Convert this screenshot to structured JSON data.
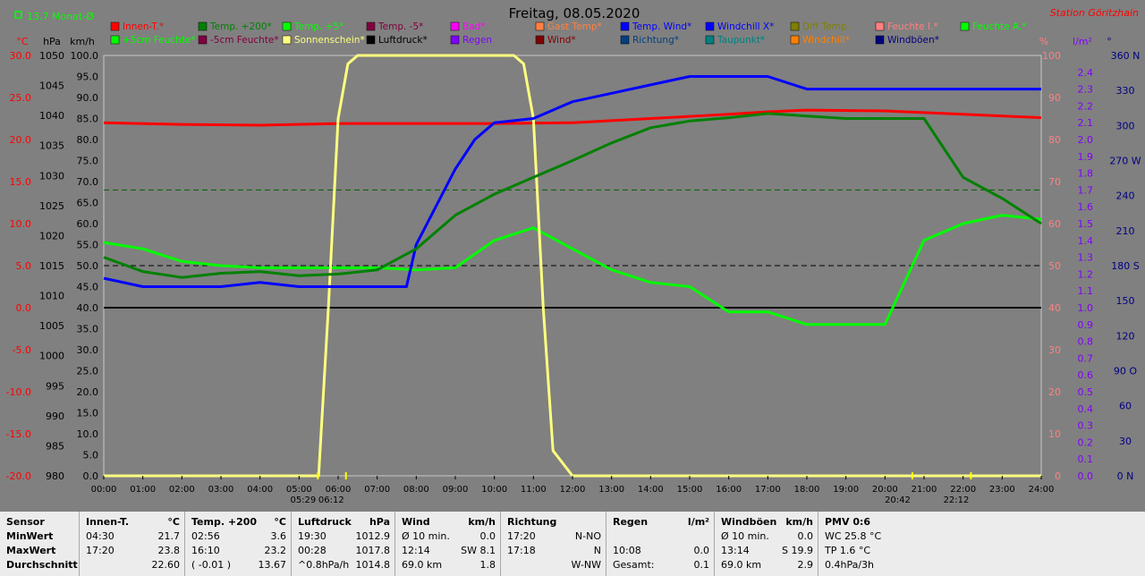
{
  "header": {
    "avg_label": "13.7 Monat-Ø",
    "title": "Freitag, 08.05.2020",
    "station": "Station Göritzhain"
  },
  "chart_data": {
    "type": "line",
    "title": "Freitag, 08.05.2020",
    "x_range": [
      0,
      24
    ],
    "x_ticks": [
      "00:00",
      "01:00",
      "02:00",
      "03:00",
      "04:00",
      "05:00",
      "06:00",
      "07:00",
      "08:00",
      "09:00",
      "10:00",
      "11:00",
      "12:00",
      "13:00",
      "14:00",
      "15:00",
      "16:00",
      "17:00",
      "18:00",
      "19:00",
      "20:00",
      "21:00",
      "22:00",
      "23:00",
      "24:00"
    ],
    "axes": {
      "celsius": {
        "label": "°C",
        "color": "#ff0000",
        "min": -20,
        "max": 30,
        "ticks": [
          "30.0",
          "25.0",
          "20.0",
          "15.0",
          "10.0",
          "5.0",
          "0.0",
          "-5.0",
          "-10.0",
          "-15.0",
          "-20.0"
        ]
      },
      "hpa": {
        "label": "hPa",
        "color": "#000000",
        "min": 980,
        "max": 1050,
        "ticks": [
          "1050",
          "1045",
          "1040",
          "1035",
          "1030",
          "1025",
          "1020",
          "1015",
          "1010",
          "1005",
          "1000",
          "995",
          "990",
          "985",
          "980"
        ]
      },
      "kmh": {
        "label": "km/h",
        "color": "#000000",
        "min": 0,
        "max": 100,
        "ticks": [
          "100.0",
          "95.0",
          "90.0",
          "85.0",
          "80.0",
          "75.0",
          "70.0",
          "65.0",
          "60.0",
          "55.0",
          "50.0",
          "45.0",
          "40.0",
          "35.0",
          "30.0",
          "25.0",
          "20.0",
          "15.0",
          "10.0",
          "5.0",
          "0.0"
        ]
      },
      "percent": {
        "label": "%",
        "color": "#ff8080",
        "min": 0,
        "max": 100,
        "ticks": [
          "100",
          "90",
          "80",
          "70",
          "60",
          "50",
          "40",
          "30",
          "20",
          "10",
          "0"
        ]
      },
      "rain": {
        "label": "l/m²",
        "color": "#8000ff",
        "min": 0,
        "max": 2.5,
        "ticks": [
          "2.4",
          "2.3",
          "2.2",
          "2.1",
          "2.0",
          "1.9",
          "1.8",
          "1.7",
          "1.6",
          "1.5",
          "1.4",
          "1.3",
          "1.2",
          "1.1",
          "1.0",
          "0.9",
          "0.8",
          "0.7",
          "0.6",
          "0.5",
          "0.4",
          "0.3",
          "0.2",
          "0.1",
          "0.0"
        ]
      },
      "direction": {
        "label": "°",
        "color": "#000080",
        "min": 0,
        "max": 360,
        "ticks": [
          "360 N",
          "330",
          "300",
          "270 W",
          "240",
          "210",
          "180 S",
          "150",
          "120",
          "90 O",
          "60",
          "30",
          "0 N"
        ]
      }
    },
    "legend": [
      {
        "name": "Innen-T.*",
        "color": "#ff0000"
      },
      {
        "name": "Temp. +200*",
        "color": "#008000"
      },
      {
        "name": "Temp. +5*",
        "color": "#00ff00"
      },
      {
        "name": "Temp. -5*",
        "color": "#800040"
      },
      {
        "name": "Bad*",
        "color": "#ff00ff"
      },
      {
        "name": "Gast Temp*",
        "color": "#ff8040"
      },
      {
        "name": "Temp. Wind*",
        "color": "#0000ff"
      },
      {
        "name": "Windchill X*",
        "color": "#0000ff"
      },
      {
        "name": "Diff Temp.",
        "color": "#808000"
      },
      {
        "name": "Feuchte I.*",
        "color": "#ff8080"
      },
      {
        "name": "Feuchte A.*",
        "color": "#00ff00"
      },
      {
        "name": "+5cm Feuchte*",
        "color": "#00ff00"
      },
      {
        "name": "-5cm Feuchte*",
        "color": "#800040"
      },
      {
        "name": "Sonnenschein*",
        "color": "#ffff80"
      },
      {
        "name": "Luftdruck*",
        "color": "#000000"
      },
      {
        "name": "Regen",
        "color": "#8000ff"
      },
      {
        "name": "Wind*",
        "color": "#800000"
      },
      {
        "name": "Richtung*",
        "color": "#004080"
      },
      {
        "name": "Taupunkt*",
        "color": "#008080"
      },
      {
        "name": "Windchill*",
        "color": "#ff8000"
      },
      {
        "name": "Windböen*",
        "color": "#000080"
      }
    ],
    "series": [
      {
        "name": "Feuchte A.*",
        "axis": "percent",
        "color": "#00ff00",
        "x": [
          0,
          1,
          2,
          3,
          4,
          5,
          6,
          7,
          8,
          9,
          10,
          11,
          12,
          13,
          14,
          15,
          16,
          17,
          18,
          19,
          20,
          21,
          22,
          23,
          24
        ],
        "values": [
          55.5,
          54,
          51,
          50,
          49.5,
          49.5,
          49.5,
          49.5,
          49,
          49.5,
          56,
          59,
          54,
          49,
          46,
          45,
          39,
          39,
          36,
          36,
          36,
          56,
          60,
          62,
          61
        ]
      },
      {
        "name": "Innen-T.*",
        "axis": "celsius",
        "color": "#ff0000",
        "x": [
          0,
          2,
          4,
          6,
          8,
          10,
          12,
          14,
          16,
          17,
          18,
          20,
          22,
          24
        ],
        "values": [
          22.0,
          21.8,
          21.7,
          21.9,
          21.9,
          21.9,
          22.0,
          22.5,
          23.0,
          23.3,
          23.5,
          23.4,
          23.0,
          22.6
        ]
      },
      {
        "name": "Sonnenschein*",
        "axis": "kmh",
        "color": "#ffff80",
        "x": [
          0,
          5.5,
          5.75,
          6,
          6.25,
          6.5,
          10.5,
          10.75,
          11,
          11.25,
          11.5,
          12,
          24
        ],
        "values": [
          0,
          0,
          40,
          85,
          98,
          100,
          100,
          98,
          85,
          40,
          6,
          0,
          0
        ]
      },
      {
        "name": "Temp. Wind*",
        "axis": "kmh",
        "color": "#0000ff",
        "x": [
          0,
          1,
          2,
          3,
          4,
          5,
          6,
          7,
          7.75,
          8,
          9,
          9.5,
          10,
          11,
          12,
          13,
          14,
          15,
          16,
          17,
          18,
          19,
          24
        ],
        "values": [
          47,
          45,
          45,
          45,
          46,
          45,
          45,
          45,
          45,
          55,
          73,
          80,
          84,
          85,
          89,
          91,
          93,
          95,
          95,
          95,
          92,
          92,
          92
        ]
      },
      {
        "name": "Temp. +200*",
        "axis": "celsius",
        "color": "#008000",
        "x": [
          0,
          1,
          2,
          3,
          4,
          5,
          6,
          7,
          8,
          9,
          10,
          11,
          12,
          13,
          14,
          15,
          16,
          17,
          18,
          19,
          20,
          21,
          22,
          23,
          24
        ],
        "values": [
          6.0,
          4.3,
          3.6,
          4.1,
          4.3,
          3.8,
          4.0,
          4.5,
          7.0,
          11.0,
          13.5,
          15.5,
          17.5,
          19.6,
          21.4,
          22.2,
          22.6,
          23.1,
          22.8,
          22.5,
          22.5,
          22.5,
          15.5,
          13.0,
          10.0
        ]
      }
    ]
  },
  "table": [
    {
      "header": [
        "Sensor"
      ],
      "rows": [
        [
          "MinWert"
        ],
        [
          "MaxWert"
        ],
        [
          "Durchschnitt"
        ]
      ]
    },
    {
      "header": [
        "Innen-T.",
        "°C"
      ],
      "rows": [
        [
          "04:30",
          "21.7"
        ],
        [
          "17:20",
          "23.8"
        ],
        [
          "",
          "22.60"
        ]
      ]
    },
    {
      "header": [
        "Temp. +200",
        "°C"
      ],
      "rows": [
        [
          "02:56",
          "3.6"
        ],
        [
          "16:10",
          "23.2"
        ],
        [
          "( -0.01 )",
          "13.67"
        ]
      ]
    },
    {
      "header": [
        "Luftdruck",
        "hPa"
      ],
      "rows": [
        [
          "19:30",
          "1012.9"
        ],
        [
          "00:28",
          "1017.8"
        ],
        [
          "^0.8hPa/h",
          "1014.8"
        ]
      ]
    },
    {
      "header": [
        "Wind",
        "km/h"
      ],
      "rows": [
        [
          "Ø 10 min.",
          "0.0"
        ],
        [
          "12:14",
          "SW 8.1"
        ],
        [
          "69.0 km",
          "1.8"
        ]
      ]
    },
    {
      "header": [
        "Richtung",
        ""
      ],
      "rows": [
        [
          "17:20",
          "N-NO"
        ],
        [
          "17:18",
          "N"
        ],
        [
          "",
          "W-NW"
        ]
      ]
    },
    {
      "header": [
        "Regen",
        "l/m²"
      ],
      "rows": [
        [
          "",
          ""
        ],
        [
          "10:08",
          "0.0"
        ],
        [
          "Gesamt:",
          "0.1"
        ]
      ]
    },
    {
      "header": [
        "Windböen",
        "km/h"
      ],
      "rows": [
        [
          "Ø 10 min.",
          "0.0"
        ],
        [
          "13:14",
          "S 19.9"
        ],
        [
          "69.0 km",
          "2.9"
        ]
      ]
    },
    {
      "header": [
        "PMV 0:6"
      ],
      "rows": [
        [
          "WC 25.8 °C"
        ],
        [
          "TP 1.6 °C"
        ],
        [
          "0.4hPa/3h"
        ]
      ]
    }
  ],
  "sun_markers": [
    "05:29",
    "06:12",
    "20:42",
    "22:12"
  ],
  "colors": {
    "background": "#808080",
    "table_bg": "#ececec",
    "zero_line": "#000000"
  }
}
